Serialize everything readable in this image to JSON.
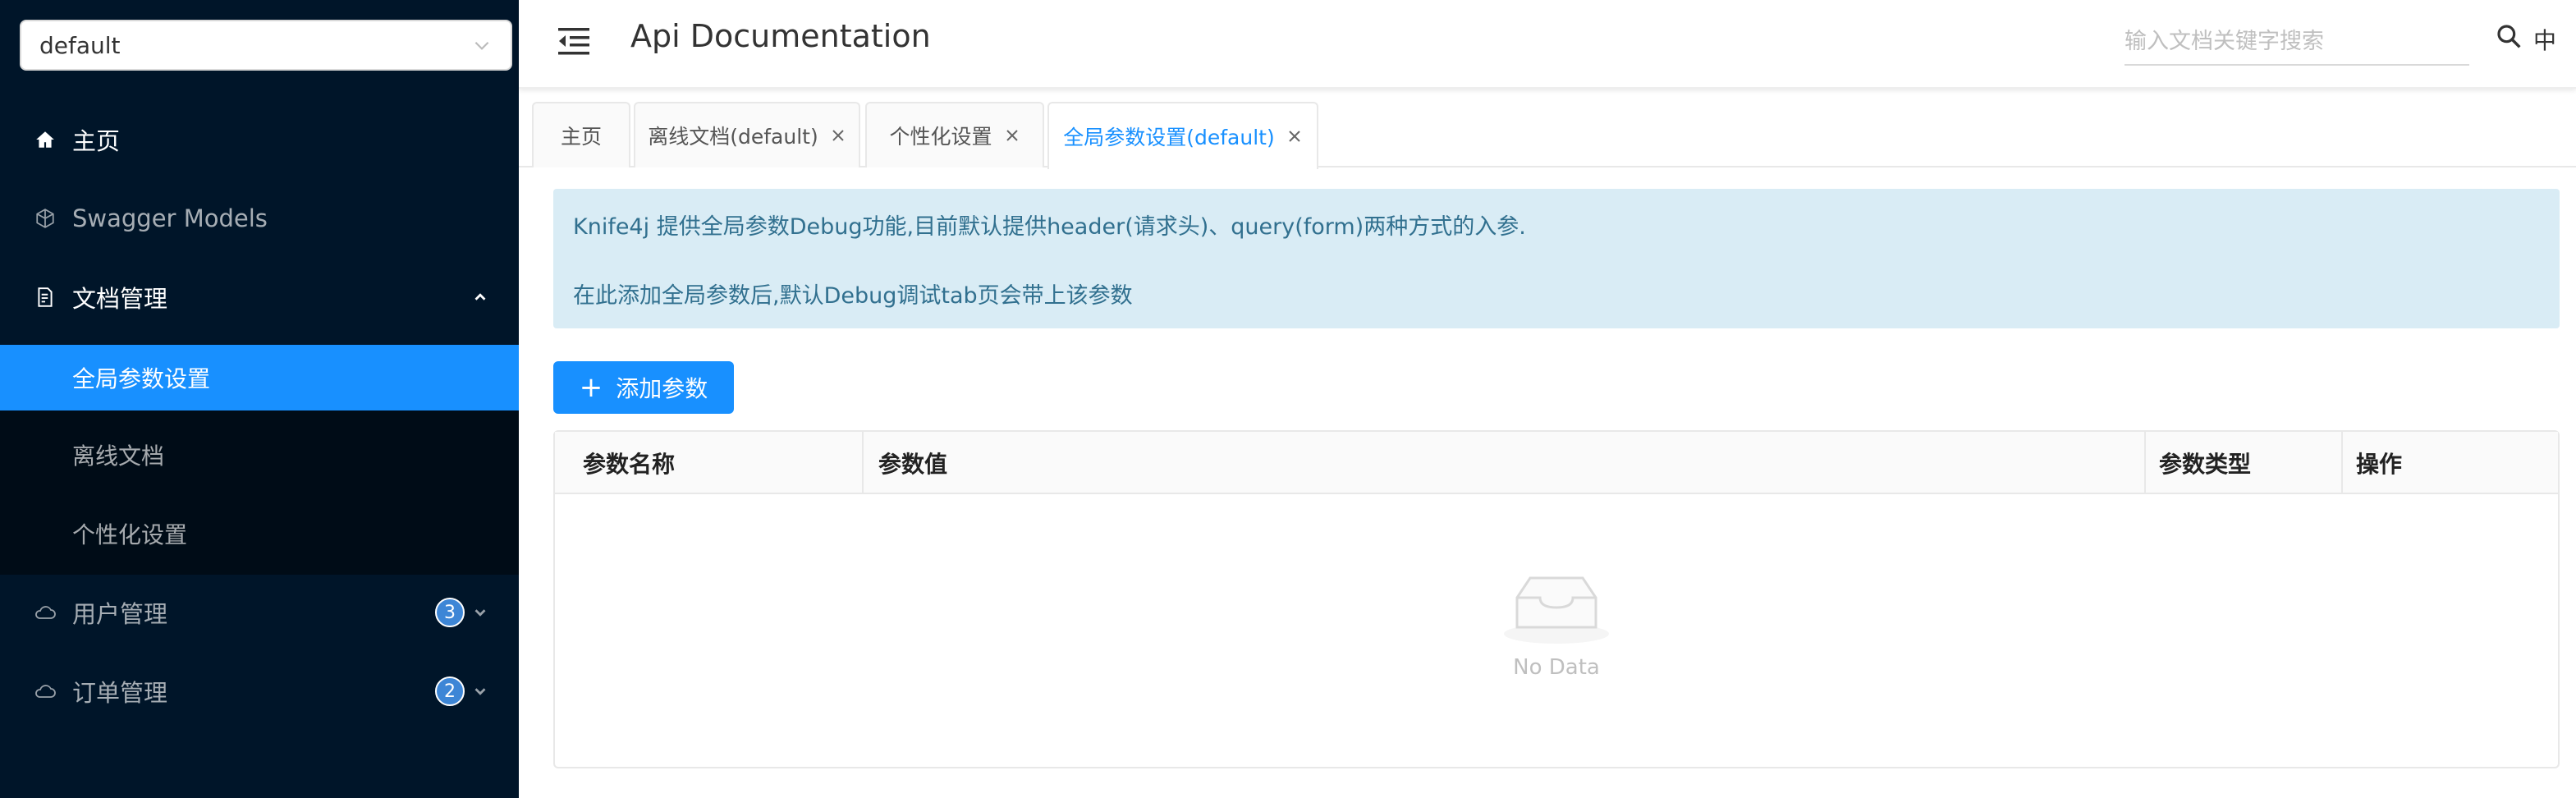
{
  "sidebar": {
    "group_select": "default",
    "items": [
      {
        "label": "主页",
        "icon": "home-icon"
      },
      {
        "label": "Swagger Models",
        "icon": "cube-icon"
      },
      {
        "label": "文档管理",
        "icon": "file-icon"
      },
      {
        "label": "用户管理",
        "icon": "cloud-icon",
        "badge": "3"
      },
      {
        "label": "订单管理",
        "icon": "cloud-icon",
        "badge": "2"
      }
    ],
    "submenu": [
      {
        "label": "全局参数设置"
      },
      {
        "label": "离线文档"
      },
      {
        "label": "个性化设置"
      }
    ]
  },
  "header": {
    "title": "Api Documentation",
    "search_placeholder": "输入文档关键字搜索",
    "lang": "中"
  },
  "tabs": [
    {
      "label": "主页"
    },
    {
      "label": "离线文档(default)"
    },
    {
      "label": "个性化设置"
    },
    {
      "label": "全局参数设置(default)"
    }
  ],
  "alert": {
    "line1": "Knife4j 提供全局参数Debug功能,目前默认提供header(请求头)、query(form)两种方式的入参.",
    "line2": "在此添加全局参数后,默认Debug调试tab页会带上该参数"
  },
  "add_button": "添加参数",
  "table": {
    "columns": [
      "参数名称",
      "参数值",
      "参数类型",
      "操作"
    ],
    "empty_text": "No Data"
  },
  "colors": {
    "sidebar_bg": "#001529",
    "accent": "#1890ff",
    "alert_bg": "#d9ecf5",
    "alert_text": "#31708f"
  }
}
